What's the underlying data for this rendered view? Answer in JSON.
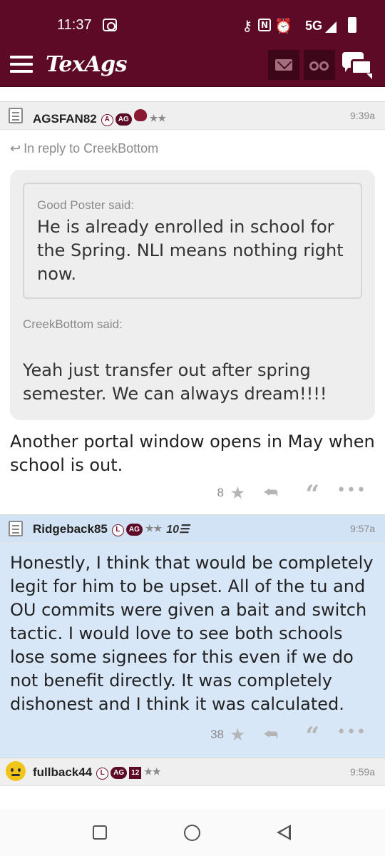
{
  "status_bar": {
    "time": "11:37",
    "network": "5G",
    "nfc_label": "N"
  },
  "app_bar": {
    "logo": "TexAgs"
  },
  "posts": [
    {
      "username": "AGSFAN82",
      "badges": [
        "A",
        "AG"
      ],
      "stars": "★★",
      "time": "9:39a",
      "reply_to": "In reply to CreekBottom",
      "quote_outer_author": "Good Poster said:",
      "quote_outer_text": "He is already enrolled in school for the Spring. NLI means nothing right now.",
      "quote_author": "CreekBottom said:",
      "quote_text": "Yeah just transfer out after spring semester. We can always dream!!!!",
      "body": "Another portal window opens in May when school is out.",
      "star_count": "8"
    },
    {
      "username": "Ridgeback85",
      "badges": [
        "L",
        "AG"
      ],
      "stars": "★★",
      "extra_badge": "10☰",
      "time": "9:57a",
      "body": "Honestly, I think that would be completely legit for him to be upset. All of the tu and OU commits were given a bait and switch tactic. I would love to see both schools lose some signees for this even if we do not benefit directly. It was completely dishonest and I think it was calculated.",
      "star_count": "38"
    },
    {
      "username": "fullback44",
      "badges": [
        "L",
        "AG",
        "12"
      ],
      "stars": "★★",
      "time": "9:59a"
    }
  ],
  "colors": {
    "maroon": "#5c0a26",
    "highlight_blue": "#d7e7f8"
  },
  "icons": {
    "menu": "hamburger-icon",
    "mail": "mail-icon",
    "binoculars": "binoculars-icon",
    "chat": "chat-icon",
    "post": "document-icon",
    "star": "star-icon",
    "reply": "reply-icon",
    "quote": "quote-icon",
    "more": "more-icon"
  }
}
